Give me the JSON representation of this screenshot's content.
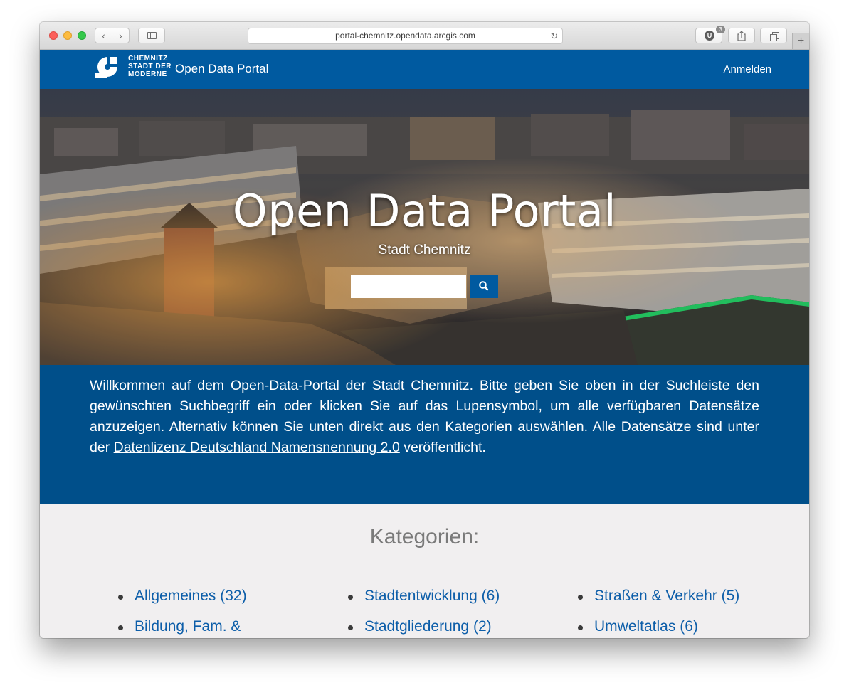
{
  "browser": {
    "url": "portal-chemnitz.opendata.arcgis.com",
    "extension_badge": "U",
    "extension_count": "3"
  },
  "header": {
    "logo_lines": [
      "CHEMNITZ",
      "STADT DER",
      "MODERNE"
    ],
    "title": "Open Data Portal",
    "login_label": "Anmelden"
  },
  "hero": {
    "title": "Open Data Portal",
    "subtitle": "Stadt Chemnitz",
    "search_value": ""
  },
  "welcome": {
    "part1": "Willkommen auf dem Open-Data-Portal der Stadt ",
    "link1": "Chemnitz",
    "part2": ". Bitte geben Sie oben in der Suchleiste den gewünschten Suchbegriff ein oder klicken Sie auf das Lupensymbol, um alle verfügbaren Datensätze anzuzeigen. Alternativ können Sie unten direkt aus den Kategorien auswählen. Alle Datensätze sind unter der ",
    "link2": "Datenlizenz Deutschland Namensnennung 2.0",
    "part3": " veröffentlicht."
  },
  "categories": {
    "heading": "Kategorien:",
    "columns": [
      [
        "Allgemeines (32)",
        "Bildung, Fam. &"
      ],
      [
        "Stadtentwicklung (6)",
        "Stadtgliederung (2)"
      ],
      [
        "Straßen & Verkehr (5)",
        "Umweltatlas (6)"
      ]
    ]
  },
  "colors": {
    "header_blue": "#005aa0",
    "welcome_blue": "#004f8a",
    "link_blue": "#0d5ea9",
    "categories_bg": "#f1eff0"
  }
}
